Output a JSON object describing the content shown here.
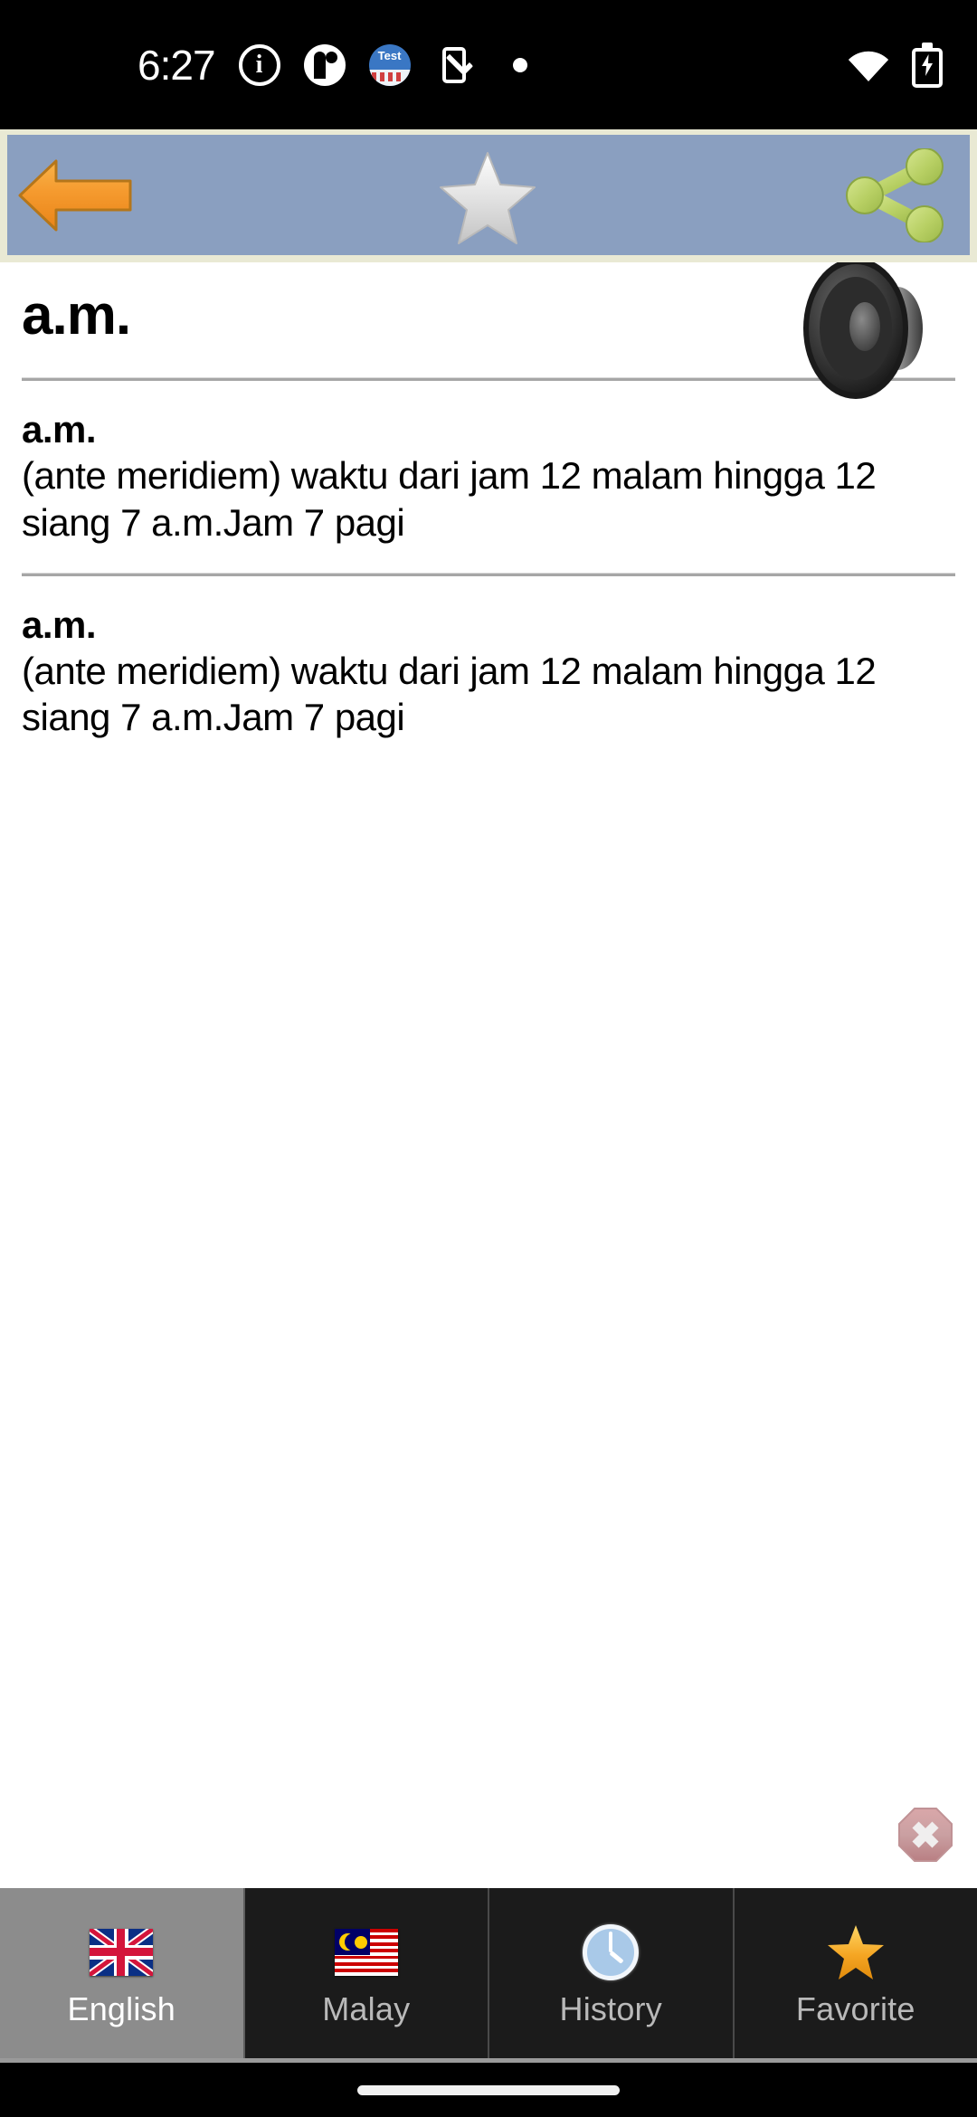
{
  "status_bar": {
    "time": "6:27",
    "icons": [
      {
        "name": "info-icon",
        "label": "info"
      },
      {
        "name": "circle-app-icon",
        "label": "app"
      },
      {
        "name": "test-app-icon",
        "label": "Test"
      },
      {
        "name": "phone-check-icon",
        "label": "device check"
      },
      {
        "name": "dot-icon",
        "label": "dot"
      }
    ],
    "wifi": "wifi-icon",
    "battery": "battery-charging-icon"
  },
  "toolbar": {
    "back_label": "Back",
    "favorite_label": "Add to favorites",
    "share_label": "Share",
    "background_color": "#8a9fc0",
    "frame_color": "#e9e9d4"
  },
  "entry": {
    "headword": "a.m.",
    "speaker_label": "Pronounce",
    "definitions": [
      {
        "term": "a.m.",
        "text": "(ante meridiem) waktu dari jam 12 malam hingga 12 siang 7 a.m.Jam 7 pagi"
      },
      {
        "term": "a.m.",
        "text": "(ante meridiem) waktu dari jam 12 malam hingga 12 siang 7 a.m.Jam 7 pagi"
      }
    ]
  },
  "close_button": {
    "label": "Close",
    "icon": "close-octagon-icon",
    "color": "#c08a8d"
  },
  "tabbar": {
    "active_index": 0,
    "active_background": "#8c8c8c",
    "background": "#1b1b1b",
    "tabs": [
      {
        "label": "English",
        "icon": "uk-flag-icon",
        "active": true
      },
      {
        "label": "Malay",
        "icon": "malaysia-flag-icon",
        "active": false
      },
      {
        "label": "History",
        "icon": "clock-icon",
        "active": false
      },
      {
        "label": "Favorite",
        "icon": "gold-star-icon",
        "active": false
      }
    ]
  },
  "system_nav": {
    "gesture_pill": "home-gesture-pill"
  }
}
